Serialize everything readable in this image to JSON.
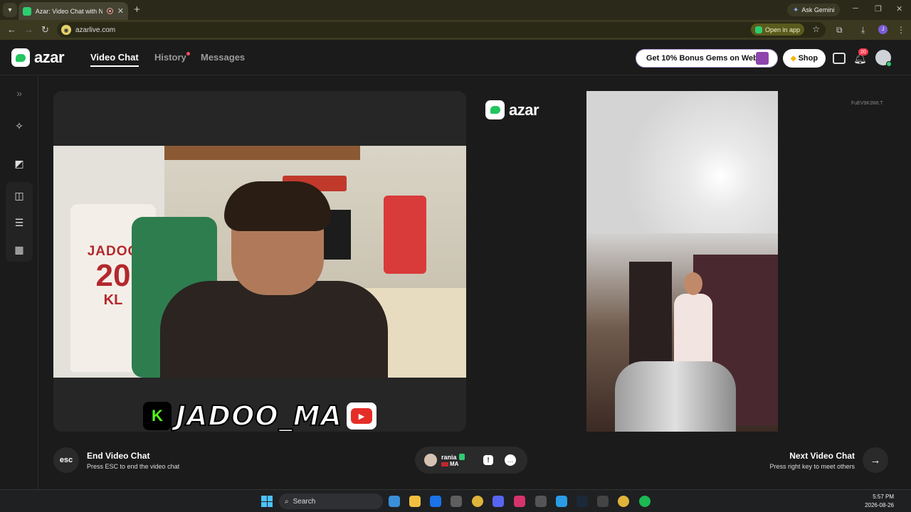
{
  "browser": {
    "tab_title": "Azar: Video Chat with New",
    "new_tab": "+",
    "ask_gemini": "Ask Gemini",
    "url": "azarlive.com",
    "open_in_app": "Open in app",
    "profile_initial": "J"
  },
  "header": {
    "logo": "azar",
    "nav": {
      "video_chat": "Video Chat",
      "history": "History",
      "messages": "Messages"
    },
    "bonus_label": "Get 10% Bonus Gems on Web!",
    "shop_label": "Shop",
    "notification_count": "20"
  },
  "sidebar": {
    "icons": [
      "expand-icon",
      "magic-wand-icon",
      "filter-icon",
      "layout-side-by-side-icon",
      "layout-stacked-icon",
      "layout-grid-icon"
    ]
  },
  "video": {
    "overlay_text": "JADOO_MA",
    "kick_letter": "K",
    "jersey_name": "JADOO",
    "jersey_number": "20",
    "jersey_kl": "KL",
    "watermark": "azar",
    "partner_id": "FuEV9K3Wt.T"
  },
  "controls": {
    "esc_label": "esc",
    "end_title": "End Video Chat",
    "end_sub": "Press ESC to end the video chat",
    "partner_name": "rania",
    "partner_country": "MA",
    "next_title": "Next Video Chat",
    "next_sub": "Press right key to meet others"
  },
  "taskbar": {
    "search_placeholder": "Search",
    "time": "5:57 PM",
    "date": "2026-08-26"
  },
  "colors": {
    "accent_green": "#22c55e",
    "notification_red": "#ff3b4e",
    "background": "#1b1b1b"
  }
}
